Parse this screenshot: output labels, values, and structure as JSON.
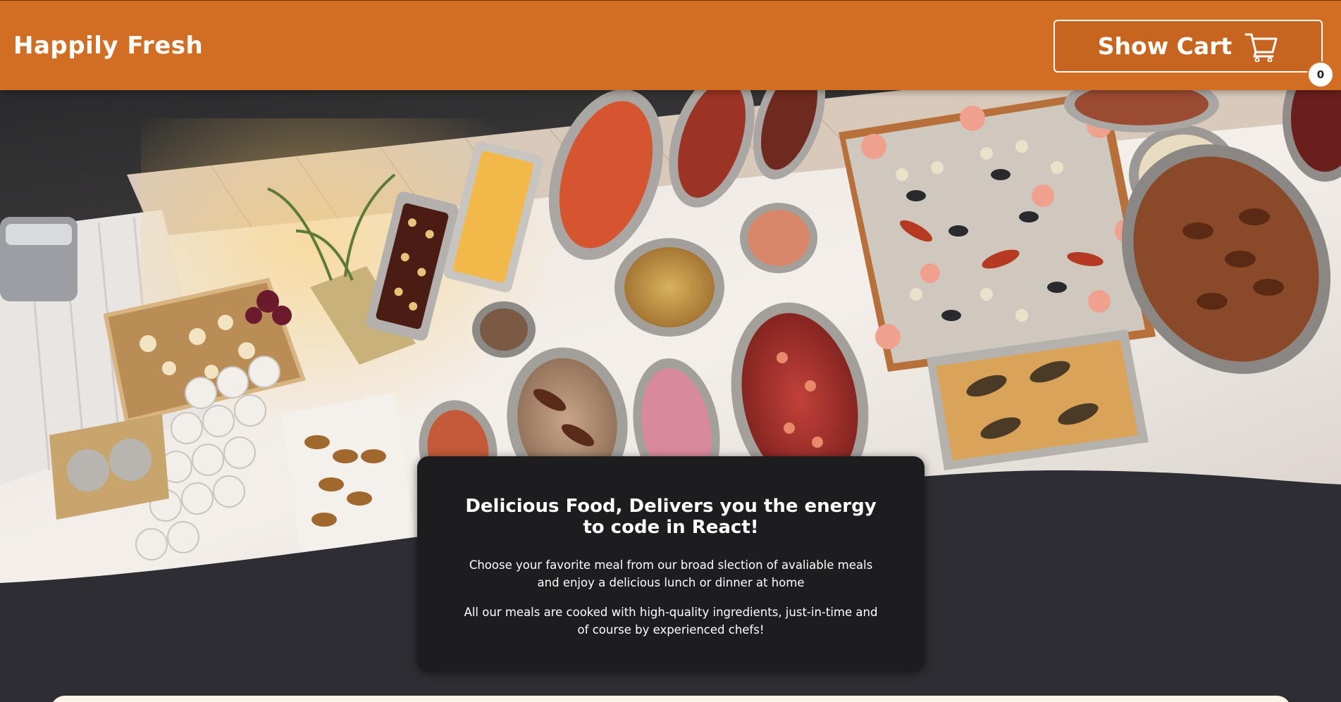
{
  "header": {
    "brand": "Happily Fresh",
    "cart_label": "Show Cart",
    "cart_count": "0",
    "cart_icon": "shopping-cart-icon"
  },
  "hero": {
    "image": "buffet-table-photo"
  },
  "summary": {
    "title": "Delicious Food, Delivers you the energy to code in React!",
    "paragraph_1": "Choose your favorite meal from our broad slection of avaliable meals and enjoy a delicious lunch or dinner at home",
    "paragraph_2": "All our meals are cooked with high-quality ingredients, just-in-time and of course by experienced chefs!"
  },
  "colors": {
    "header_bg": "#d26e24",
    "page_bg": "#2e2d33",
    "card_bg": "#1d1d20",
    "text": "#ffffff"
  }
}
